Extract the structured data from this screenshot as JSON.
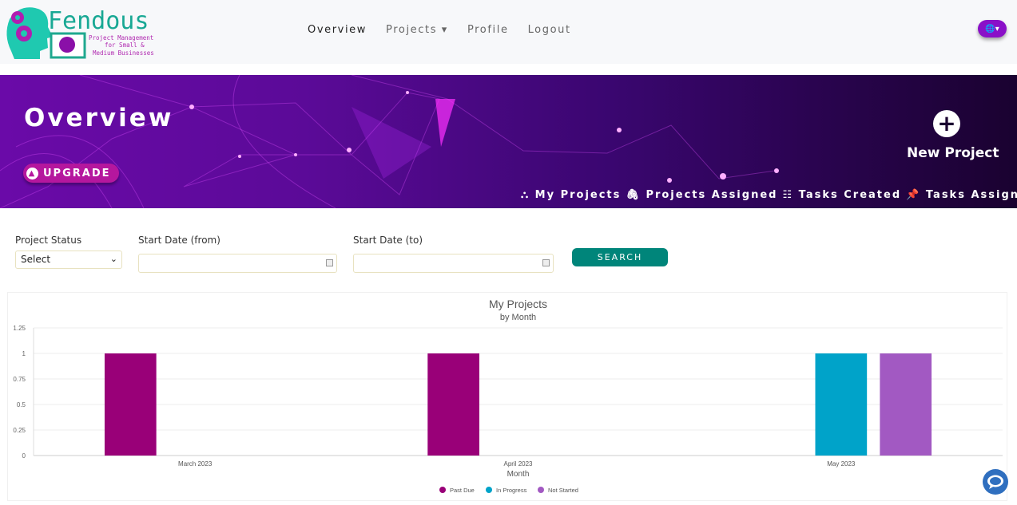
{
  "brand": {
    "name": "Fendous",
    "tagline": [
      "Project Management",
      "for Small &",
      "Medium Businesses"
    ]
  },
  "nav": {
    "items": [
      {
        "label": "Overview",
        "active": true
      },
      {
        "label": "Projects ▾"
      },
      {
        "label": "Profile"
      },
      {
        "label": "Logout"
      }
    ],
    "language_icon": "globe-icon"
  },
  "banner": {
    "title": "Overview",
    "upgrade_label": "UPGRADE",
    "new_project_label": "New Project",
    "links": [
      {
        "icon": "sitemap-icon",
        "glyph": "⛬",
        "label": "My Projects"
      },
      {
        "icon": "paperclip-icon",
        "glyph": "🖇",
        "label": "Projects Assigned"
      },
      {
        "icon": "list-check-icon",
        "glyph": "☷",
        "label": "Tasks Created"
      },
      {
        "icon": "pin-icon",
        "glyph": "📌",
        "label": "Tasks Assigned"
      }
    ]
  },
  "filters": {
    "status_label": "Project Status",
    "status_value": "Select",
    "from_label": "Start Date (from)",
    "from_value": "",
    "to_label": "Start Date (to)",
    "to_value": "",
    "search_label": "SEARCH"
  },
  "chart_data": {
    "type": "bar",
    "title": "My Projects",
    "subtitle": "by Month",
    "xlabel": "Month",
    "ylabel": "",
    "categories": [
      "March 2023",
      "April 2023",
      "May 2023"
    ],
    "series": [
      {
        "name": "Past Due",
        "color": "#990078",
        "values": [
          1,
          1,
          0
        ]
      },
      {
        "name": "In Progress",
        "color": "#00a3c9",
        "values": [
          0,
          0,
          1
        ]
      },
      {
        "name": "Not Started",
        "color": "#a259c2",
        "values": [
          0,
          0,
          1
        ]
      }
    ],
    "ylim": [
      0,
      1.25
    ],
    "yticks": [
      "0",
      "0.25",
      "0.5",
      "0.75",
      "1",
      "1.25"
    ],
    "grid": true,
    "legend": "bottom"
  }
}
